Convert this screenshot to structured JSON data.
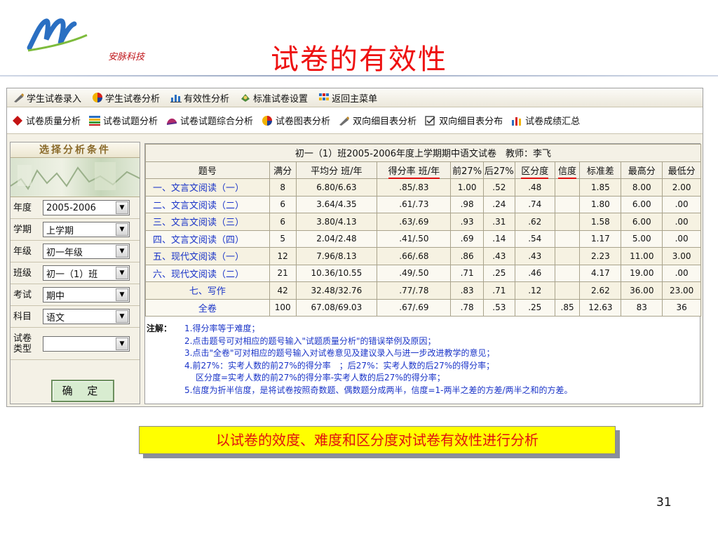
{
  "slide": {
    "logo_text": "安脉科技",
    "title": "试卷的有效性",
    "caption": "以试卷的效度、难度和区分度对试卷有效性进行分析",
    "page_number": "31"
  },
  "menubar": [
    {
      "label": "学生试卷录入",
      "icon": "pen-icon"
    },
    {
      "label": "学生试卷分析",
      "icon": "pie-chart-icon"
    },
    {
      "label": "有效性分析",
      "icon": "bar-chart-icon"
    },
    {
      "label": "标准试卷设置",
      "icon": "settings-icon"
    },
    {
      "label": "返回主菜单",
      "icon": "grid-icon"
    }
  ],
  "toolbar": [
    {
      "label": "试卷质量分析",
      "icon": "diamond-icon"
    },
    {
      "label": "试卷试题分析",
      "icon": "stripes-icon"
    },
    {
      "label": "试卷试题综合分析",
      "icon": "hat-icon"
    },
    {
      "label": "试卷图表分析",
      "icon": "pie-chart-icon"
    },
    {
      "label": "双向细目表分析",
      "icon": "pen-icon"
    },
    {
      "label": "双向细目表分布",
      "icon": "checkbox-icon"
    },
    {
      "label": "试卷成绩汇总",
      "icon": "bar-chart-icon"
    }
  ],
  "conditions": {
    "title": "选择分析条件",
    "fields": [
      {
        "label": "年度",
        "value": "2005-2006"
      },
      {
        "label": "学期",
        "value": "上学期"
      },
      {
        "label": "年级",
        "value": "初一年级"
      },
      {
        "label": "班级",
        "value": "初一（1）班"
      },
      {
        "label": "考试",
        "value": "期中"
      },
      {
        "label": "科目",
        "value": "语文"
      },
      {
        "label": "试卷类型",
        "value": ""
      }
    ],
    "confirm_label": "确 定"
  },
  "results": {
    "caption": "初一（1）班2005-2006年度上学期期中语文试卷　教师：李飞",
    "headers": [
      "题号",
      "满分",
      "平均分 班/年",
      "得分率 班/年",
      "前27%",
      "后27%",
      "区分度",
      "信度",
      "标准差",
      "最高分",
      "最低分"
    ],
    "rows": [
      [
        "一、文言文阅读（一）",
        "8",
        "6.80/6.63",
        ".85/.83",
        "1.00",
        ".52",
        ".48",
        "",
        "1.85",
        "8.00",
        "2.00"
      ],
      [
        "二、文言文阅读（二）",
        "6",
        "3.64/4.35",
        ".61/.73",
        ".98",
        ".24",
        ".74",
        "",
        "1.80",
        "6.00",
        ".00"
      ],
      [
        "三、文言文阅读（三）",
        "6",
        "3.80/4.13",
        ".63/.69",
        ".93",
        ".31",
        ".62",
        "",
        "1.58",
        "6.00",
        ".00"
      ],
      [
        "四、文言文阅读（四）",
        "5",
        "2.04/2.48",
        ".41/.50",
        ".69",
        ".14",
        ".54",
        "",
        "1.17",
        "5.00",
        ".00"
      ],
      [
        "五、现代文阅读（一）",
        "12",
        "7.96/8.13",
        ".66/.68",
        ".86",
        ".43",
        ".43",
        "",
        "2.23",
        "11.00",
        "3.00"
      ],
      [
        "六、现代文阅读（二）",
        "21",
        "10.36/10.55",
        ".49/.50",
        ".71",
        ".25",
        ".46",
        "",
        "4.17",
        "19.00",
        ".00"
      ],
      [
        "七、写作",
        "42",
        "32.48/32.76",
        ".77/.78",
        ".83",
        ".71",
        ".12",
        "",
        "2.62",
        "36.00",
        "23.00"
      ],
      [
        "全卷",
        "100",
        "67.08/69.03",
        ".67/.69",
        ".78",
        ".53",
        ".25",
        ".85",
        "12.63",
        "83",
        "36"
      ]
    ]
  },
  "notes": {
    "lead": "注解：",
    "items": [
      "1.得分率等于难度；",
      "2.点击题号可对相应的题号输入\"试题质量分析\"的错误举例及原因；",
      "3.点击\"全卷\"可对相应的题号输入对试卷意见及建议录入与进一步改进教学的意见；",
      "4.前27%：实考人数的前27%的得分率　；后27%：实考人数的后27%的得分率；",
      "区分度=实考人数的前27%的得分率-实考人数的后27%的得分率；",
      "5.信度为折半信度，是将试卷按照奇数题、偶数题分成两半，信度=1-两半之差的方差/两半之和的方差。"
    ]
  },
  "colors": {
    "title_red": "#ee1111",
    "link_blue": "#1a34c8",
    "caption_yellow": "#ffff00",
    "panel_beige": "#f4f1e6"
  }
}
